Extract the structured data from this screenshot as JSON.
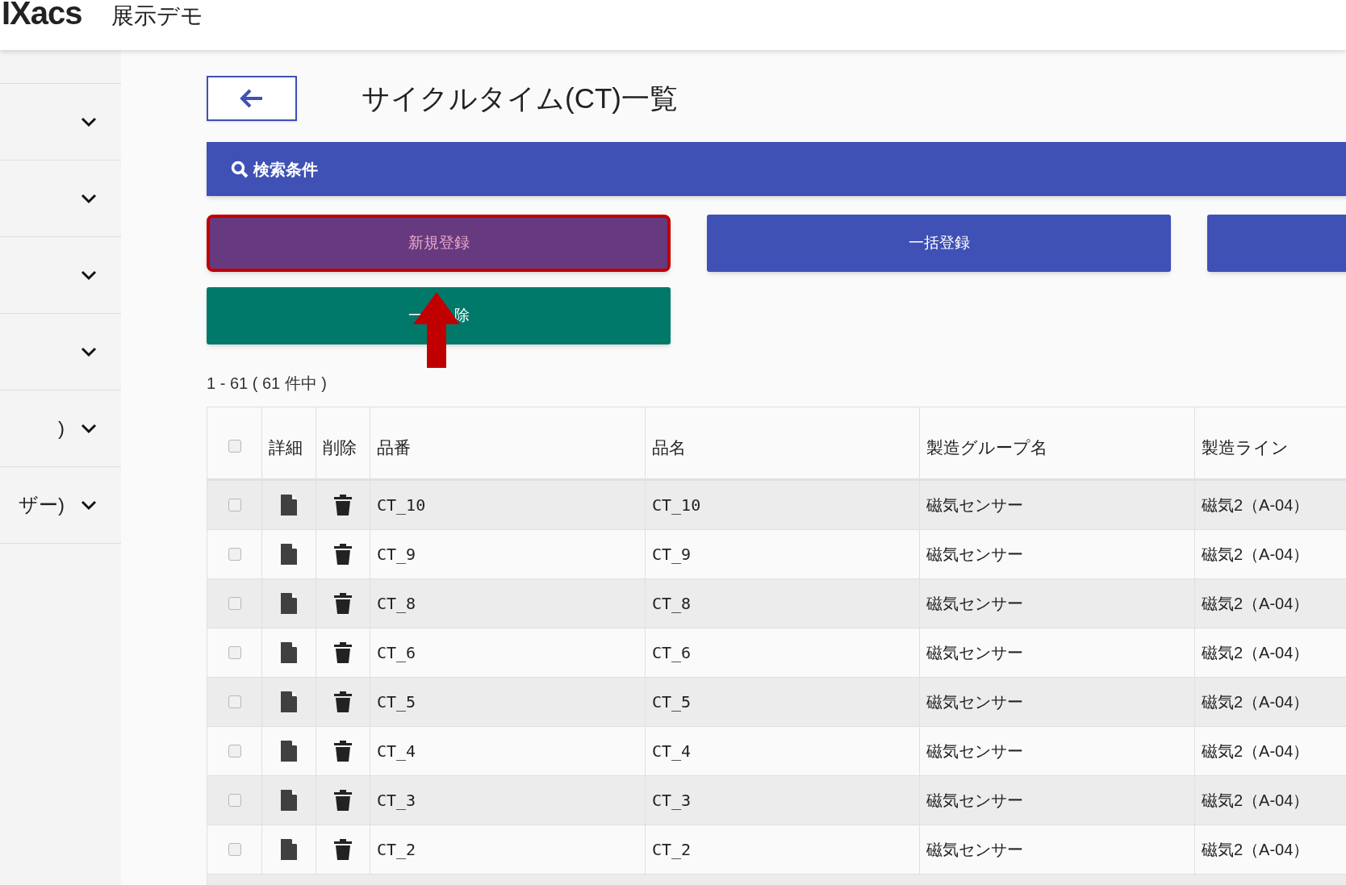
{
  "header": {
    "logo": "IXacs",
    "app_name": "展示デモ"
  },
  "sidebar": {
    "items": [
      {
        "expanded": false
      },
      {
        "expanded": false
      },
      {
        "expanded": false
      },
      {
        "expanded": false
      },
      {
        "label": ")",
        "expanded": false
      },
      {
        "label": "ザー)",
        "expanded": false
      }
    ]
  },
  "page": {
    "title": "サイクルタイム(CT)一覧"
  },
  "search_panel": {
    "label": "検索条件"
  },
  "buttons": [
    {
      "label": "新規登録",
      "color": "#673a7f",
      "highlighted": true
    },
    {
      "label": "一括登録",
      "color": "#3f51b5",
      "highlighted": false
    },
    {
      "color": "#3f51b5",
      "highlighted": false
    },
    {
      "label": "一　　除",
      "color": "#00796b",
      "highlighted": false
    }
  ],
  "count": "1 - 61 ( 61 件中 )",
  "table": {
    "icon_columns": [
      "詳細",
      "削除"
    ],
    "columns": [
      "品番",
      "品名",
      "製造グループ名",
      "製造ライン"
    ],
    "header_checked": false,
    "rows": [
      {
        "checked": false,
        "cells": [
          "CT_10",
          "CT_10",
          "磁気センサー",
          "磁気2（A-04）"
        ]
      },
      {
        "checked": false,
        "cells": [
          "CT_9",
          "CT_9",
          "磁気センサー",
          "磁気2（A-04）"
        ]
      },
      {
        "checked": false,
        "cells": [
          "CT_8",
          "CT_8",
          "磁気センサー",
          "磁気2（A-04）"
        ]
      },
      {
        "checked": false,
        "cells": [
          "CT_6",
          "CT_6",
          "磁気センサー",
          "磁気2（A-04）"
        ]
      },
      {
        "checked": false,
        "cells": [
          "CT_5",
          "CT_5",
          "磁気センサー",
          "磁気2（A-04）"
        ]
      },
      {
        "checked": false,
        "cells": [
          "CT_4",
          "CT_4",
          "磁気センサー",
          "磁気2（A-04）"
        ]
      },
      {
        "checked": false,
        "cells": [
          "CT_3",
          "CT_3",
          "磁気センサー",
          "磁気2（A-04）"
        ]
      },
      {
        "checked": false,
        "cells": [
          "CT_2",
          "CT_2",
          "磁気センサー",
          "磁気2（A-04）"
        ]
      }
    ]
  }
}
